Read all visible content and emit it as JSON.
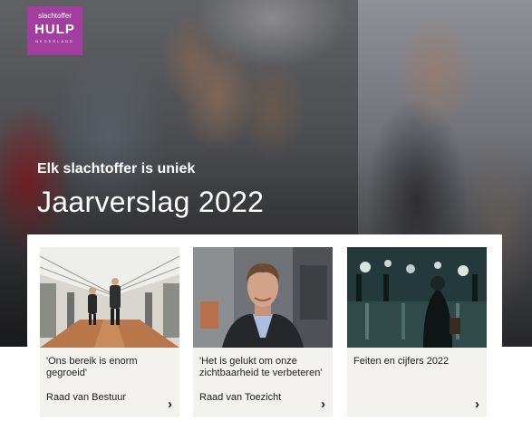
{
  "logo": {
    "top": "slachtoffer",
    "mid": "HULP",
    "bottom": "NEDERLAND"
  },
  "hero": {
    "subtitle": "Elk slachtoffer is uniek",
    "title": "Jaarverslag 2022"
  },
  "cards": [
    {
      "quote": "'Ons bereik is enorm gegroeid'",
      "sub": "Raad van Bestuur",
      "chevron": "›"
    },
    {
      "quote": "'Het is gelukt om onze zichtbaarheid te verbeteren'",
      "sub": "Raad van Toezicht",
      "chevron": "›"
    },
    {
      "quote": "Feiten en cijfers 2022",
      "sub": "",
      "chevron": "›"
    }
  ],
  "colors": {
    "brand": "#a23ea0",
    "card_bg": "#f3f2ee"
  }
}
